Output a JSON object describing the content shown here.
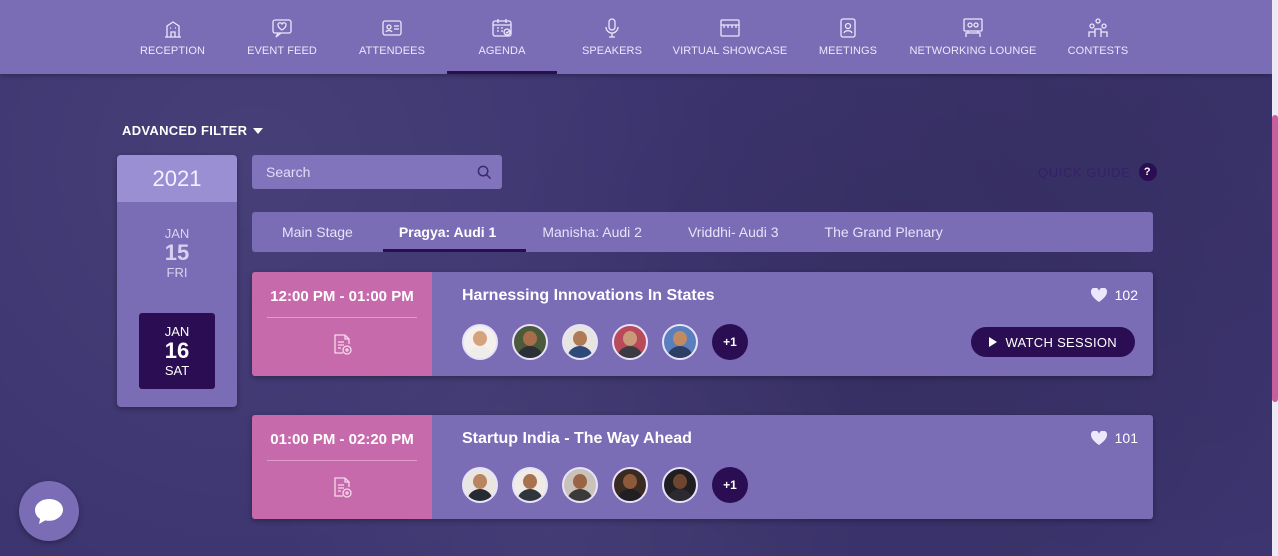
{
  "nav": [
    {
      "label": "RECEPTION",
      "icon": "building-icon",
      "active": false
    },
    {
      "label": "EVENT FEED",
      "icon": "heart-message-icon",
      "active": false
    },
    {
      "label": "ATTENDEES",
      "icon": "id-card-icon",
      "active": false
    },
    {
      "label": "AGENDA",
      "icon": "calendar-icon",
      "active": true
    },
    {
      "label": "SPEAKERS",
      "icon": "microphone-icon",
      "active": false
    },
    {
      "label": "VIRTUAL SHOWCASE",
      "icon": "booth-icon",
      "active": false
    },
    {
      "label": "MEETINGS",
      "icon": "meeting-icon",
      "active": false
    },
    {
      "label": "NETWORKING LOUNGE",
      "icon": "lounge-icon",
      "active": false
    },
    {
      "label": "CONTESTS",
      "icon": "trophy-people-icon",
      "active": false
    }
  ],
  "filter": {
    "label": "ADVANCED FILTER"
  },
  "dates": {
    "year": "2021",
    "items": [
      {
        "month": "JAN",
        "day": "15",
        "weekday": "FRI",
        "selected": false
      },
      {
        "month": "JAN",
        "day": "16",
        "weekday": "SAT",
        "selected": true
      }
    ]
  },
  "search": {
    "placeholder": "Search"
  },
  "quick_guide": {
    "label": "QUICK GUIDE",
    "icon_text": "?"
  },
  "tabs": [
    {
      "label": "Main Stage",
      "active": false
    },
    {
      "label": "Pragya: Audi 1",
      "active": true
    },
    {
      "label": "Manisha: Audi 2",
      "active": false
    },
    {
      "label": "Vriddhi- Audi 3",
      "active": false
    },
    {
      "label": "The Grand Plenary",
      "active": false
    }
  ],
  "sessions": [
    {
      "time": "12:00 PM - 01:00 PM",
      "title": "Harnessing Innovations In States",
      "likes": "102",
      "speakers_more": "+1",
      "watch_label": "WATCH SESSION"
    },
    {
      "time": "01:00 PM - 02:20 PM",
      "title": "Startup India - The Way Ahead",
      "likes": "101",
      "speakers_more": "+1"
    }
  ],
  "colors": {
    "nav_bg": "#7a6cb5",
    "page_bg": "#3d3570",
    "accent_dark": "#2b0d53",
    "time_block": "#c76aab",
    "scroll_thumb": "#c95f9f"
  }
}
